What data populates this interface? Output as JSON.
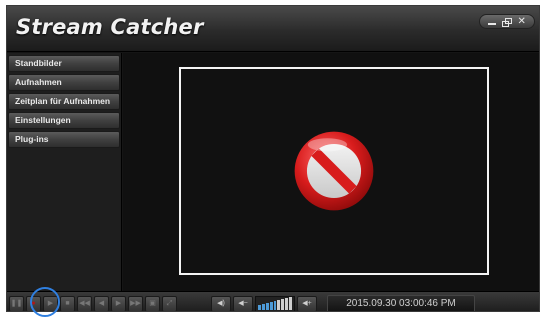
{
  "window": {
    "title": "Stream Catcher"
  },
  "sidebar": {
    "items": [
      {
        "label": "Standbilder"
      },
      {
        "label": "Aufnahmen"
      },
      {
        "label": "Zeitplan für Aufnahmen"
      },
      {
        "label": "Einstellungen"
      },
      {
        "label": "Plug-ins"
      }
    ]
  },
  "video": {
    "status_icon": "no-entry-icon"
  },
  "player": {
    "datetime": "2015.09.30  03:00:46 PM"
  },
  "colors": {
    "accent_highlight": "#2f7fe0",
    "record_red": "#d01818",
    "volume_blue": "#4d9bd8"
  }
}
